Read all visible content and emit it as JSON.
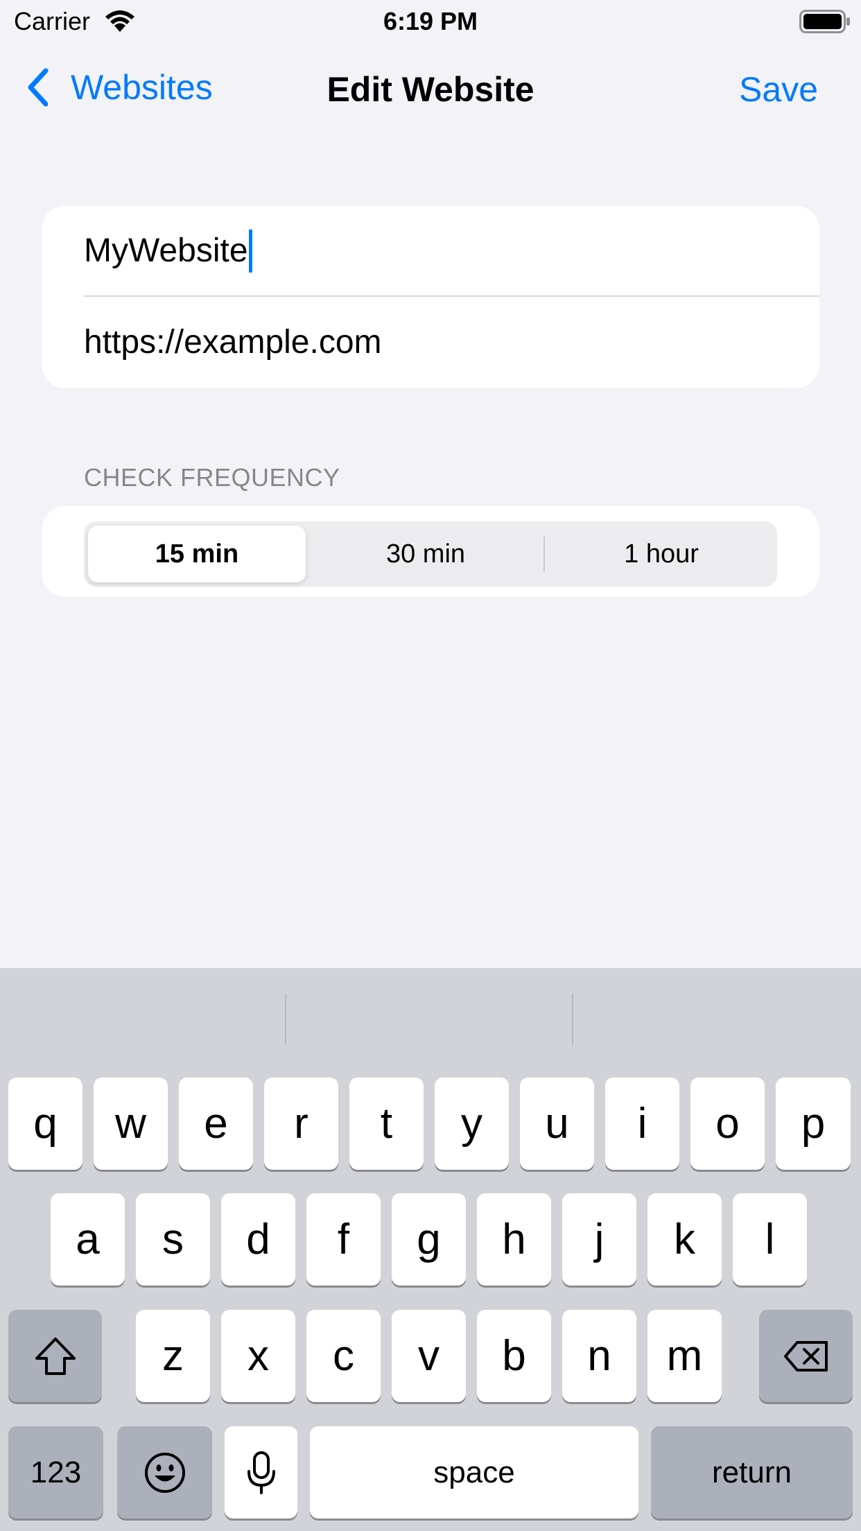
{
  "status_bar": {
    "carrier": "Carrier",
    "time": "6:19 PM"
  },
  "nav": {
    "back_label": "Websites",
    "title": "Edit Website",
    "save_label": "Save"
  },
  "form": {
    "name_value": "MyWebsite",
    "url_value": "https://example.com"
  },
  "frequency": {
    "header": "CHECK FREQUENCY",
    "options": [
      "15 min",
      "30 min",
      "1 hour"
    ],
    "selected": "15 min"
  },
  "keyboard": {
    "row1": [
      "q",
      "w",
      "e",
      "r",
      "t",
      "y",
      "u",
      "i",
      "o",
      "p"
    ],
    "row2": [
      "a",
      "s",
      "d",
      "f",
      "g",
      "h",
      "j",
      "k",
      "l"
    ],
    "row3": [
      "z",
      "x",
      "c",
      "v",
      "b",
      "n",
      "m"
    ],
    "numbers_label": "123",
    "space_label": "space",
    "return_label": "return"
  },
  "colors": {
    "accent": "#007aff",
    "background": "#f2f2f7",
    "keyboard_bg": "#d1d3d9"
  }
}
